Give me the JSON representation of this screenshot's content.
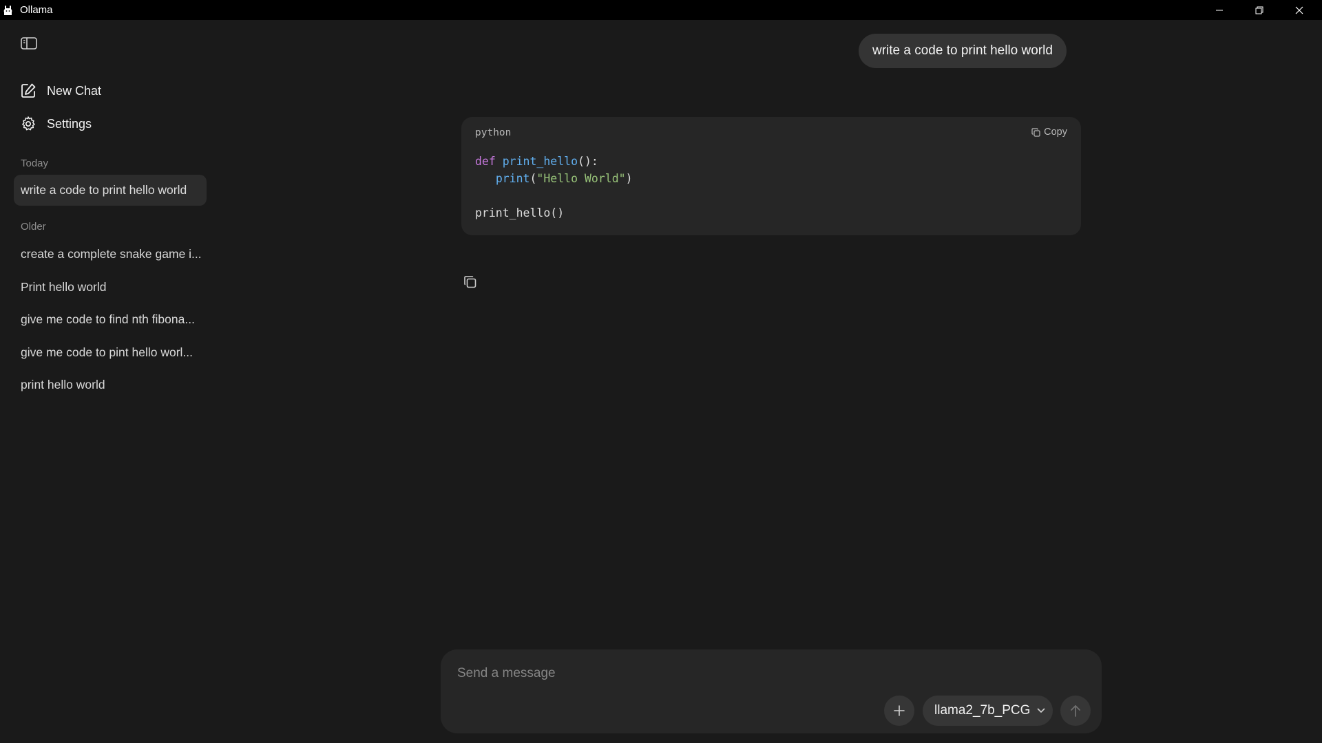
{
  "window": {
    "title": "Ollama",
    "controls": {
      "minimize_icon": "minimize-icon",
      "restore_icon": "restore-icon",
      "close_icon": "close-icon"
    }
  },
  "sidebar": {
    "toggle_icon": "sidebar-toggle-icon",
    "nav": [
      {
        "label": "New Chat",
        "icon": "new-chat-icon"
      },
      {
        "label": "Settings",
        "icon": "gear-icon"
      }
    ],
    "sections": [
      {
        "label": "Today",
        "items": [
          {
            "label": "write a code to print hello world",
            "active": true
          }
        ]
      },
      {
        "label": "Older",
        "items": [
          {
            "label": "create a complete snake game i..."
          },
          {
            "label": "Print hello world"
          },
          {
            "label": "give me code to find nth fibona..."
          },
          {
            "label": "give me code to pint hello worl..."
          },
          {
            "label": "print hello world"
          }
        ]
      }
    ]
  },
  "conversation": {
    "user_message": "write a code to print hello world",
    "code_block": {
      "language": "python",
      "copy_label": "Copy",
      "lines": [
        {
          "kw": "def",
          "fn": "print_hello",
          "rest": "():"
        },
        {
          "indent": "   ",
          "fn": "print",
          "open": "(",
          "str": "\"Hello World\"",
          "close": ")"
        },
        {
          "text": ""
        },
        {
          "text": "print_hello()"
        }
      ]
    }
  },
  "composer": {
    "placeholder": "Send a message",
    "model": "llama2_7b_PCG",
    "attach_icon": "plus-icon",
    "send_icon": "arrow-up-icon"
  },
  "colors": {
    "background": "#1a1a1a",
    "titlebar": "#000000",
    "panel": "#262626",
    "bubble": "#343434",
    "keyword": "#c678dd",
    "function": "#61afef",
    "string": "#98c379"
  }
}
